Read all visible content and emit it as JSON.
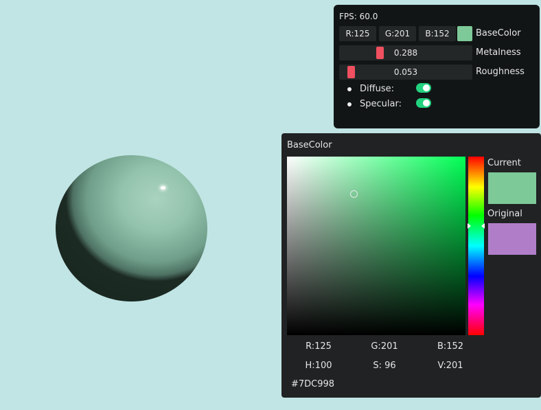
{
  "scene": {
    "object": "sphere"
  },
  "panel": {
    "fps": "FPS: 60.0",
    "base_color": {
      "r": "R:125",
      "g": "G:201",
      "b": "B:152",
      "label": "BaseColor",
      "swatch": "#7dc998"
    },
    "metalness": {
      "value": "0.288",
      "label": "Metalness",
      "level": 0.288
    },
    "roughness": {
      "value": "0.053",
      "label": "Roughness",
      "level": 0.053
    },
    "diffuse": {
      "label": "Diffuse:",
      "on": true
    },
    "specular": {
      "label": "Specular:",
      "on": true
    }
  },
  "color_picker": {
    "title": "BaseColor",
    "current_label": "Current",
    "current_color": "#7dc998",
    "original_label": "Original",
    "original_color": "#b07ec9",
    "r": "R:125",
    "g": "G:201",
    "b": "B:152",
    "h": "H:100",
    "s": "S: 96",
    "v": "V:201",
    "hex": "#7DC998"
  }
}
